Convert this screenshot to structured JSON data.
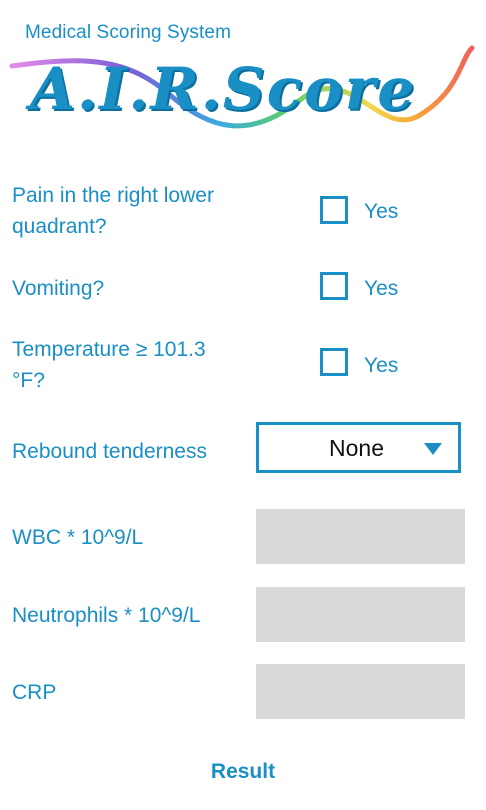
{
  "header": {
    "subtitle": "Medical Scoring System",
    "logo_text": "A.I.R.Score",
    "rainbow_colors": [
      "#e07fe0",
      "#8a5fd8",
      "#4a78e0",
      "#35b5d8",
      "#5ccf6a",
      "#f2d84a",
      "#f59c3c",
      "#ef5f5f"
    ]
  },
  "questions": {
    "pain_label": "Pain in the right lower quadrant?",
    "vomiting_label": "Vomiting?",
    "temperature_label": "Temperature ≥ 101.3 °F?",
    "yes_label": "Yes"
  },
  "rebound": {
    "label": "Rebound tenderness",
    "selected": "None"
  },
  "labs": {
    "wbc_label": "WBC * 10^9/L",
    "neutrophils_label": "Neutrophils * 10^9/L",
    "crp_label": "CRP"
  },
  "footer": {
    "result_label": "Result"
  },
  "colors": {
    "accent": "#1a8fc6",
    "field_bg": "#d9d9d9"
  }
}
